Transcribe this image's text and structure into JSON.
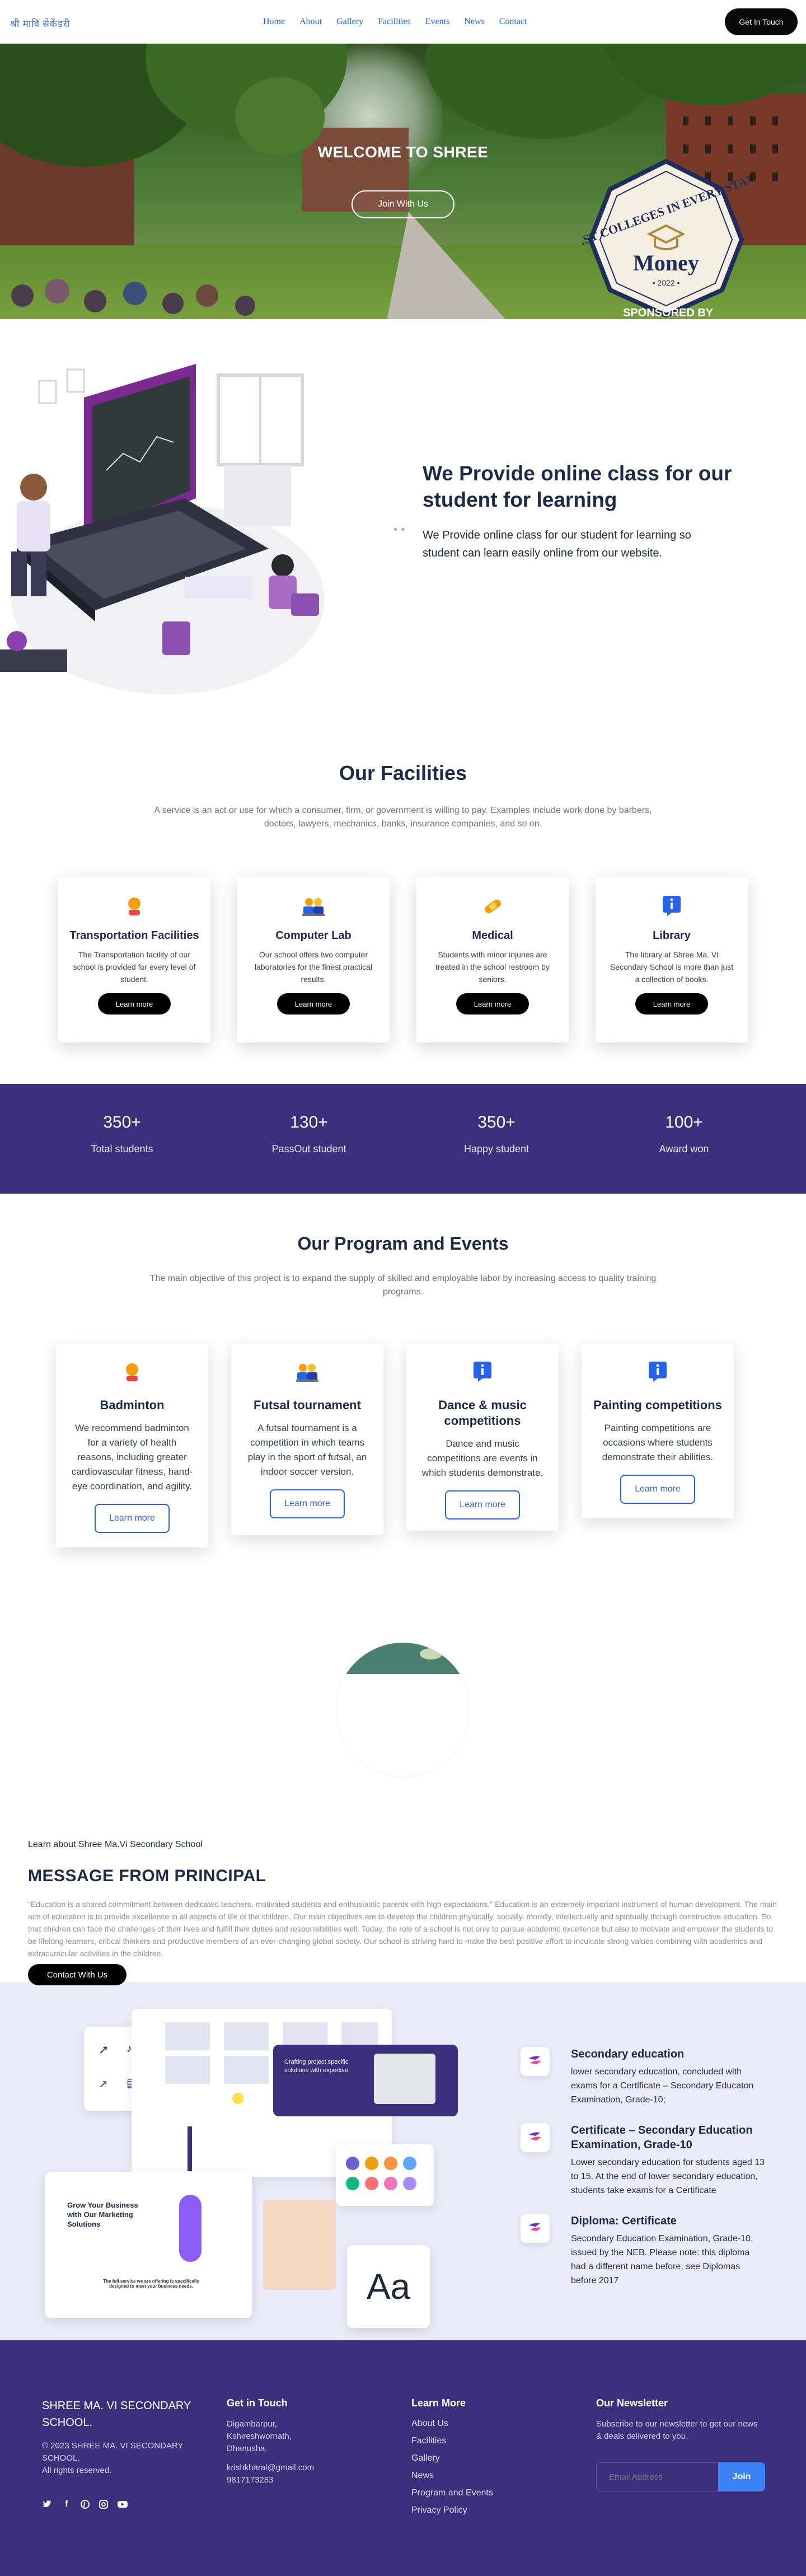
{
  "nav": {
    "logo": "श्री मावि सेकेंडरी",
    "links": [
      "Home",
      "About",
      "Gallery",
      "Facilities",
      "Events",
      "News",
      "Contact"
    ],
    "cta": "Get In Touch"
  },
  "hero": {
    "title": "WELCOME TO SHREE",
    "button": "Join With Us",
    "badge_top": "BEST COLLEGES IN EVERY STATE",
    "badge_money": "Money",
    "badge_year": "• 2022 •",
    "badge_sponsor": "SPONSORED BY"
  },
  "online": {
    "title": "We Provide online class for our student for learning",
    "text": "We Provide online class for our student for learning so student can learn easily online from our website."
  },
  "facilities": {
    "title": "Our Facilities",
    "subtitle": "A service is an act or use for which a consumer, firm, or government is willing to pay. Examples include work done by barbers, doctors, lawyers, mechanics, banks, insurance companies, and so on.",
    "cards": [
      {
        "title": "Transportation Facilities",
        "text": "The Transportation facility of our school is provided for every level of student.",
        "button": "Learn more",
        "icon": "person-icon"
      },
      {
        "title": "Computer Lab",
        "text": "Our school offers two computer laboratories for the finest practical results.",
        "button": "Learn more",
        "icon": "group-icon"
      },
      {
        "title": "Medical",
        "text": "Students with minor injuries are treated in the school restroom by seniors.",
        "button": "Learn more",
        "icon": "bandage-icon"
      },
      {
        "title": "Library",
        "text": "The library at Shree Ma. Vi Secondary School is more than just a collection of books.",
        "button": "Learn more",
        "icon": "info-icon"
      }
    ]
  },
  "stats": [
    {
      "value": "350+",
      "label": "Total students"
    },
    {
      "value": "130+",
      "label": "PassOut student"
    },
    {
      "value": "350+",
      "label": "Happy student"
    },
    {
      "value": "100+",
      "label": "Award won"
    }
  ],
  "program": {
    "title": "Our Program and Events",
    "subtitle": "The main objective of this project is to expand the supply of skilled and employable labor by increasing access to quality training programs.",
    "cards": [
      {
        "title": "Badminton",
        "text": "We recommend badminton for a variety of health reasons, including greater cardiovascular fitness, hand-eye coordination, and agility.",
        "button": "Learn more",
        "icon": "person-icon"
      },
      {
        "title": "Futsal tournament",
        "text": "A futsal tournament is a competition in which teams play in the sport of futsal, an indoor soccer version.",
        "button": "Learn more",
        "icon": "group-icon"
      },
      {
        "title": "Dance & music competitions",
        "text": "Dance and music competitions are events in which students demonstrate.",
        "button": "Learn more",
        "icon": "info-icon"
      },
      {
        "title": "Painting competitions",
        "text": "Painting competitions are occasions where students demonstrate their abilities.",
        "button": "Learn more",
        "icon": "info-icon"
      }
    ]
  },
  "principal": {
    "eyebrow": "Learn about Shree Ma.Vi Secondary School",
    "title": "MESSAGE FROM PRINCIPAL",
    "text": "\"Education is a shared commitment between dedicated teachers, motivated students and enthusiastic parents with high expectations.\" Education is an extremely important instrument of human development. The main aim of education is to provide excellence in all aspects of life of the children. Our main objectives are to develop the children physically, socially, morally, intellectually and spiritually through constructive education. So that children can face the challenges of their lives and fulfill their duties and responsibilities well. Today, the role of a school is not only to pursue academic excellence but also to motivate and empower the students to be lifelong learners, critical thinkers and productive members of an ever-changing global society. Our school is striving hard to make the best positive effort to inculcate strong values combining with academics and extracurricular activities in the children.",
    "button": "Contact With Us"
  },
  "education": {
    "mockup_heading": "Grow Your Business with Our Marketing Solutions",
    "mockup_sub": "The full service we are offering is specifically designed to meet your business needs.",
    "mockup_card": "Crafting project specific solutions with expertise.",
    "aa": "Aa",
    "items": [
      {
        "title": "Secondary education",
        "text": "lower secondary education, concluded with exams for a Certificate – Secondary Educaton Examination, Grade-10;"
      },
      {
        "title": "Certificate – Secondary Education Examination, Grade-10",
        "text": "Lower secondary education for students aged 13 to 15. At the end of lower secondary education, students take exams for a Certificate"
      },
      {
        "title": "Diploma: Certificate",
        "text": "Secondary Education Examination, Grade-10, issued by the NEB. Please note: this diploma had a different name before; see Diplomas before 2017"
      }
    ]
  },
  "footer": {
    "school": "SHREE MA. VI SECONDARY SCHOOL.",
    "copyright": "© 2023 SHREE MA. VI SECONDARY SCHOOL.",
    "rights": "All rights reserved.",
    "touch_title": "Get in Touch",
    "address1": "Digambarpur,",
    "address2": "Kshireshwornath,",
    "address3": "Dhanusha.",
    "email": "krishkharal@gmail.com",
    "phone": "9817173283",
    "learn_title": "Learn More",
    "learn_links": [
      "About Us",
      "Facilities",
      "Gallery",
      "News",
      "Program and Events",
      "Privacy Policy"
    ],
    "news_title": "Our Newsletter",
    "news_text": "Subscribe to our newsletter to get our news & deals delivered to you.",
    "email_placeholder": "Email Address",
    "join": "Join",
    "social_icons": [
      "twitter-icon",
      "facebook-icon",
      "pinterest-icon",
      "instagram-icon",
      "youtube-icon"
    ]
  },
  "colors": {
    "primary": "#3c2f7c",
    "accent": "#2563eb",
    "button": "#000000",
    "newsletter": "#3b82f6"
  }
}
